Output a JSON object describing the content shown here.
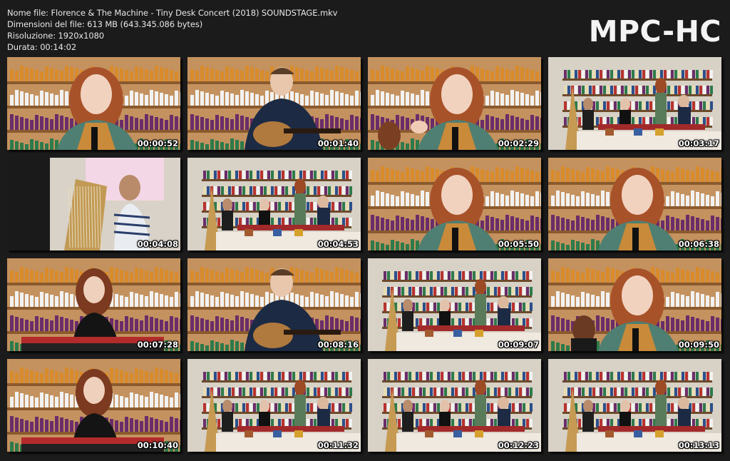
{
  "info": {
    "file_name": "Nome file: Florence & The Machine - Tiny Desk Concert (2018) SOUNDSTAGE.mkv",
    "file_size": "Dimensioni del file: 613 MB (643.345.086 bytes)",
    "resolution": "Risoluzione: 1920x1080",
    "duration": "Durata: 00:14:02"
  },
  "brand": "MPC-HC",
  "thumbnails": [
    {
      "time": "00:00:52",
      "scene": "closeup-singer"
    },
    {
      "time": "00:01:40",
      "scene": "guitarist"
    },
    {
      "time": "00:02:29",
      "scene": "closeup-singer-hand"
    },
    {
      "time": "00:03:17",
      "scene": "wide-band"
    },
    {
      "time": "00:04:08",
      "scene": "harpist"
    },
    {
      "time": "00:04:53",
      "scene": "wide-band"
    },
    {
      "time": "00:05:50",
      "scene": "closeup-singer"
    },
    {
      "time": "00:06:38",
      "scene": "closeup-singer"
    },
    {
      "time": "00:07:28",
      "scene": "keyboardist"
    },
    {
      "time": "00:08:16",
      "scene": "guitarist"
    },
    {
      "time": "00:09:07",
      "scene": "wide-band"
    },
    {
      "time": "00:09:50",
      "scene": "singer-two-shot"
    },
    {
      "time": "00:10:40",
      "scene": "keyboardist"
    },
    {
      "time": "00:11:32",
      "scene": "wide-band"
    },
    {
      "time": "00:12:23",
      "scene": "wide-band"
    },
    {
      "time": "00:13:13",
      "scene": "wide-band"
    }
  ]
}
